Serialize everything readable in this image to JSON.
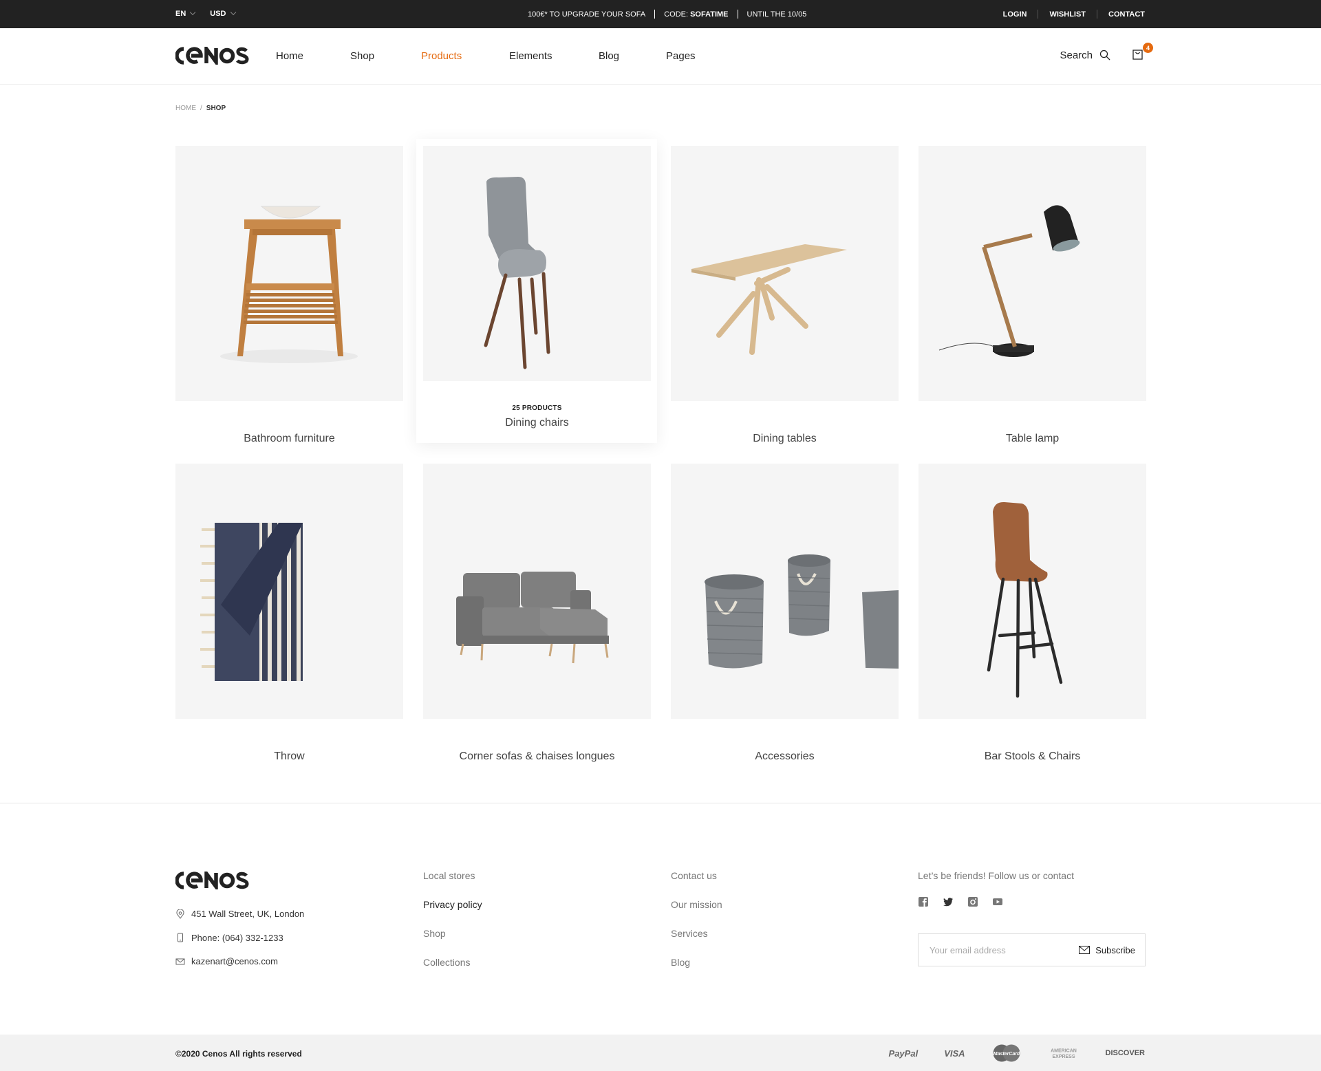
{
  "topbar": {
    "language": "EN",
    "currency": "USD",
    "promo_text": "100€* TO UPGRADE YOUR SOFA",
    "promo_code_label": "CODE:",
    "promo_code": "SOFATIME",
    "promo_until": "UNTIL THE 10/05",
    "links": [
      "LOGIN",
      "WISHLIST",
      "CONTACT"
    ]
  },
  "header": {
    "logo_text": "CENOS",
    "nav": [
      {
        "label": "Home",
        "active": false
      },
      {
        "label": "Shop",
        "active": false
      },
      {
        "label": "Products",
        "active": true
      },
      {
        "label": "Elements",
        "active": false
      },
      {
        "label": "Blog",
        "active": false
      },
      {
        "label": "Pages",
        "active": false
      }
    ],
    "search_label": "Search",
    "cart_count": "4",
    "accent_color": "#e56a0f"
  },
  "breadcrumb": {
    "home": "HOME",
    "separator": "/",
    "current": "SHOP"
  },
  "categories": [
    {
      "title": "Bathroom furniture",
      "count": "",
      "image": "wooden-washstand"
    },
    {
      "title": "Dining chairs",
      "count": "25 PRODUCTS",
      "image": "grey-dining-chair",
      "hovered": true
    },
    {
      "title": "Dining tables",
      "count": "",
      "image": "oak-dining-table"
    },
    {
      "title": "Table lamp",
      "count": "",
      "image": "black-desk-lamp"
    },
    {
      "title": "Throw",
      "count": "",
      "image": "striped-throw-blanket"
    },
    {
      "title": "Corner sofas & chaises longues",
      "count": "",
      "image": "grey-corner-sofa"
    },
    {
      "title": "Accessories",
      "count": "",
      "image": "grey-rope-baskets"
    },
    {
      "title": "Bar Stools & Chairs",
      "count": "",
      "image": "leather-bar-stool"
    }
  ],
  "footer": {
    "logo_text": "CENOS",
    "address": "451 Wall Street, UK, London",
    "phone": "Phone: (064) 332-1233",
    "email": "kazenart@cenos.com",
    "col1": [
      "Local stores",
      "Privacy policy",
      "Shop",
      "Collections"
    ],
    "col2": [
      "Contact us",
      "Our mission",
      "Services",
      "Blog"
    ],
    "social_text": "Let’s be friends! Follow us or contact",
    "social": [
      "facebook",
      "twitter",
      "instagram",
      "youtube"
    ],
    "email_placeholder": "Your email address",
    "subscribe_label": "Subscribe",
    "copyright": "©2020 Cenos All rights reserved",
    "payments": [
      "PayPal",
      "VISA",
      "MasterCard",
      "AMERICAN EXPRESS",
      "DISCOVER"
    ]
  }
}
